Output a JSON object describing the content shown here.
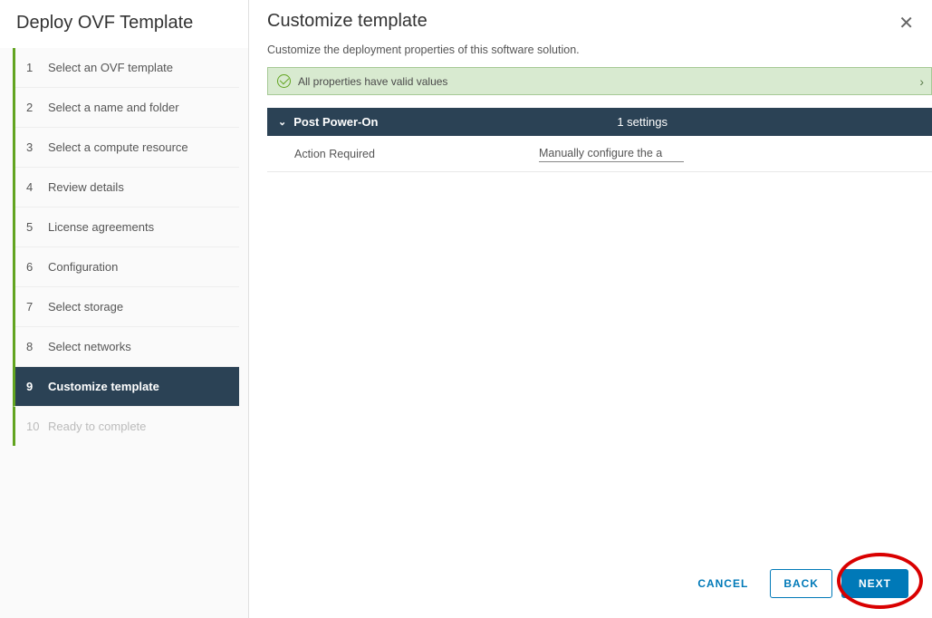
{
  "sidebar": {
    "title": "Deploy OVF Template",
    "steps": [
      {
        "num": "1",
        "label": "Select an OVF template",
        "state": "done"
      },
      {
        "num": "2",
        "label": "Select a name and folder",
        "state": "done"
      },
      {
        "num": "3",
        "label": "Select a compute resource",
        "state": "done"
      },
      {
        "num": "4",
        "label": "Review details",
        "state": "done"
      },
      {
        "num": "5",
        "label": "License agreements",
        "state": "done"
      },
      {
        "num": "6",
        "label": "Configuration",
        "state": "done"
      },
      {
        "num": "7",
        "label": "Select storage",
        "state": "done"
      },
      {
        "num": "8",
        "label": "Select networks",
        "state": "done"
      },
      {
        "num": "9",
        "label": "Customize template",
        "state": "active"
      },
      {
        "num": "10",
        "label": "Ready to complete",
        "state": "disabled"
      }
    ]
  },
  "main": {
    "title": "Customize template",
    "subtitle": "Customize the deployment properties of this software solution.",
    "validation": "All properties have valid values",
    "section": {
      "title": "Post Power-On",
      "count": "1 settings",
      "rows": [
        {
          "label": "Action Required",
          "value": "Manually configure the a"
        }
      ]
    }
  },
  "footer": {
    "cancel": "CANCEL",
    "back": "BACK",
    "next": "NEXT"
  }
}
